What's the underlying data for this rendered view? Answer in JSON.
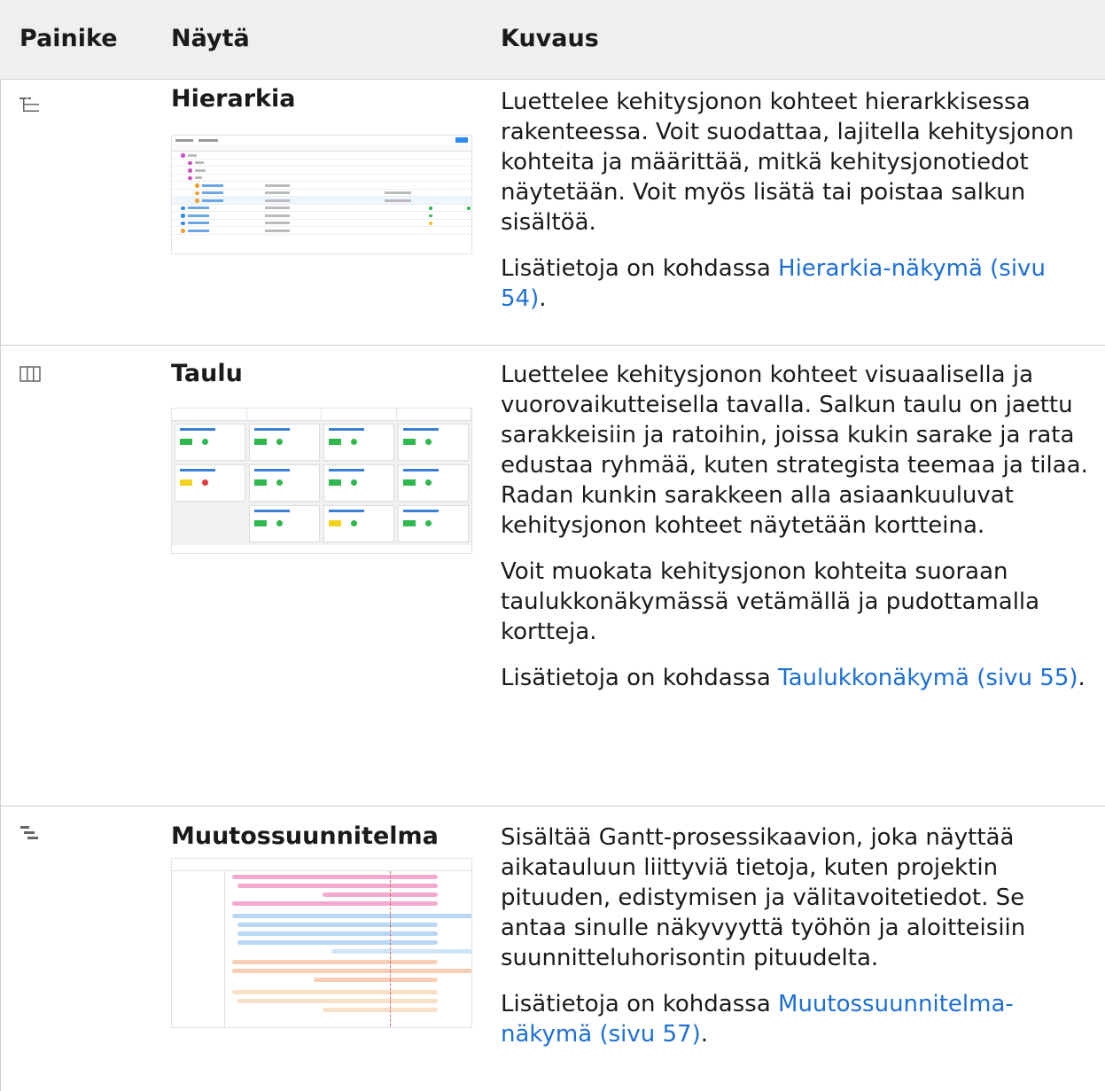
{
  "table": {
    "headers": [
      "Painike",
      "Näytä",
      "Kuvaus"
    ]
  },
  "rows": [
    {
      "icon": "hierarchy-icon",
      "title": "Hierarkia",
      "desc1": "Luettelee kehitysjonon kohteet hierarkkisessa rakenteessa. Voit suodattaa, lajitella kehitysjonon kohteita ja määrittää, mitkä kehitysjonotiedot näytetään. Voit myös lisätä tai poistaa salkun sisältöä.",
      "more_prefix": "Lisätietoja on kohdassa ",
      "link": "Hierarkia-näkymä (sivu 54)",
      "more_suffix": "."
    },
    {
      "icon": "board-icon",
      "title": "Taulu",
      "desc1": "Luettelee kehitysjonon kohteet visuaalisella ja vuorovaikutteisella tavalla. Salkun taulu on jaettu sarakkeisiin ja ratoihin, joissa kukin sarake ja rata edustaa ryhmää, kuten strategista teemaa ja tilaa. Radan kunkin sarakkeen alla asiaankuuluvat kehitysjonon kohteet näytetään kortteina.",
      "desc2": "Voit muokata kehitysjonon kohteita suoraan taulukkonäkymässä vetämällä ja pudottamalla kortteja.",
      "more_prefix": "Lisätietoja on kohdassa ",
      "link": "Taulukkonäkymä (sivu 55)",
      "more_suffix": "."
    },
    {
      "icon": "roadmap-icon",
      "title": "Muutossuunnitelma",
      "desc1": "Sisältää Gantt-prosessikaavion, joka näyttää aikatauluun liittyviä tietoja, kuten projektin pituuden, edistymisen ja välitavoitetiedot. Se antaa sinulle näkyvyyttä työhön ja aloitteisiin suunnitteluhorisontin pituudelta.",
      "more_prefix": "Lisätietoja on kohdassa ",
      "link": "Muutossuunnitelma-näkymä (sivu 57)",
      "more_suffix": "."
    }
  ],
  "colors": {
    "link": "#1d6fd6",
    "header_bg": "#efefef"
  }
}
